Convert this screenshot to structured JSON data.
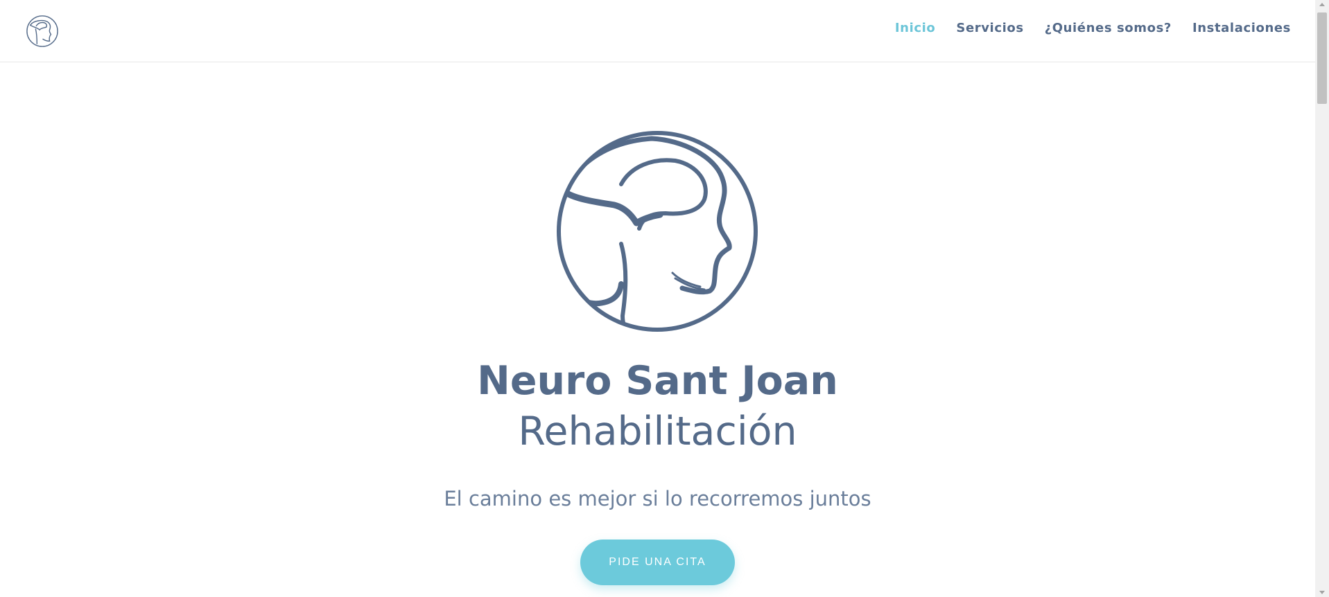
{
  "nav": {
    "items": [
      {
        "label": "Inicio",
        "active": true
      },
      {
        "label": "Servicios",
        "active": false
      },
      {
        "label": "¿Quiénes somos?",
        "active": false
      },
      {
        "label": "Instalaciones",
        "active": false
      }
    ]
  },
  "hero": {
    "title": "Neuro Sant Joan",
    "subtitle": "Rehabilitación",
    "tagline": "El camino es mejor si lo recorremos juntos",
    "cta_label": "PIDE UNA CITA"
  },
  "icons": {
    "logo": "head-profile-brain-icon"
  },
  "colors": {
    "primary": "#546a89",
    "accent": "#6ccadb",
    "active_nav": "#6cc5d8"
  }
}
